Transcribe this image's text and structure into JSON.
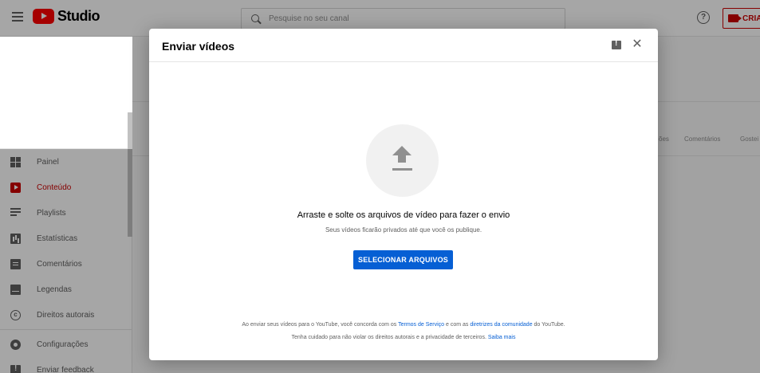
{
  "topbar": {
    "logo_text": "Studio",
    "search_placeholder": "Pesquise no seu canal",
    "help_label": "?",
    "create_label": "CRIAR"
  },
  "sidebar": {
    "items": [
      {
        "label": "Painel",
        "icon": "dashboard-icon",
        "active": false
      },
      {
        "label": "Conteúdo",
        "icon": "content-icon",
        "active": true
      },
      {
        "label": "Playlists",
        "icon": "playlist-icon",
        "active": false
      },
      {
        "label": "Estatísticas",
        "icon": "stats-icon",
        "active": false
      },
      {
        "label": "Comentários",
        "icon": "comments-icon",
        "active": false
      },
      {
        "label": "Legendas",
        "icon": "subtitles-icon",
        "active": false
      },
      {
        "label": "Direitos autorais",
        "icon": "copyright-icon",
        "active": false
      },
      {
        "label": "Configurações",
        "icon": "gear-icon",
        "active": false
      },
      {
        "label": "Enviar feedback",
        "icon": "feedback-icon",
        "active": false
      }
    ]
  },
  "background": {
    "columns": [
      "ões",
      "Comentários",
      "Gostei"
    ]
  },
  "modal": {
    "title": "Enviar vídeos",
    "close_symbol": "✕",
    "dropzone_main": "Arraste e solte os arquivos de vídeo para fazer o envio",
    "dropzone_sub": "Seus vídeos ficarão privados até que você os publique.",
    "select_button": "SELECIONAR ARQUIVOS",
    "legal_1_prefix": "Ao enviar seus vídeos para o YouTube, você concorda com os ",
    "legal_1_link1": "Termos de Serviço",
    "legal_1_middle": " e com as ",
    "legal_1_link2": "diretrizes da comunidade",
    "legal_1_suffix": " do YouTube.",
    "legal_2_prefix": "Tenha cuidado para não violar os direitos autorais e a privacidade de terceiros. ",
    "legal_2_link": "Saiba mais"
  },
  "colors": {
    "brand_red": "#ff0000",
    "active_red": "#cc0000",
    "primary_blue": "#065fd4"
  }
}
